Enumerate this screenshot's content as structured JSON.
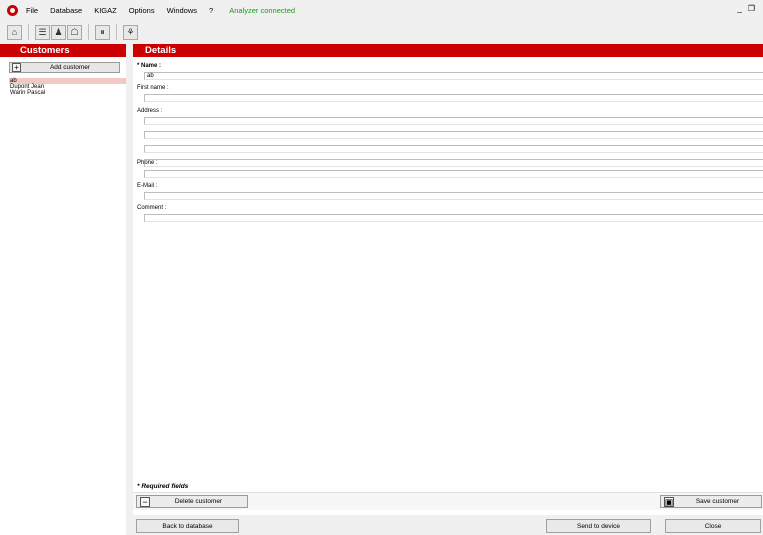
{
  "menubar": {
    "items": [
      "File",
      "Database",
      "KIGAZ",
      "Options",
      "Windows",
      "?"
    ],
    "status": "Analyzer connected",
    "minimize": "_",
    "restore": "❐"
  },
  "toolbar": {
    "icons": [
      "home-icon",
      "database-icon",
      "customer-icon",
      "site-icon",
      "analyzer-icon",
      "tools-icon"
    ],
    "glyphs": [
      "⌂",
      "☰",
      "♟",
      "☖",
      "⏸",
      "⚘"
    ]
  },
  "customers": {
    "header": "Customers",
    "add_button": "Add customer",
    "add_icon": "+",
    "list": [
      "ab",
      "Dupont Jean",
      "Warin Pascal"
    ],
    "selected_index": 0
  },
  "details": {
    "header": "Details",
    "name_label": "Name :",
    "name_value": "ab",
    "firstname_label": "First name :",
    "firstname_value": "",
    "address_label": "Address :",
    "address_lines": [
      "",
      "",
      "",
      ""
    ],
    "phone_label": "Phone :",
    "phone_value": "",
    "email_label": "E-Mail :",
    "email_value": "",
    "comment_label": "Comment :",
    "comment_value": "",
    "required_note": "Required fields",
    "required_marker": "*",
    "delete_button": "Delete customer",
    "delete_icon": "−",
    "save_button": "Save customer",
    "save_icon": "▣"
  },
  "footer": {
    "back_button": "Back to database",
    "send_button": "Send to device",
    "close_button": "Close"
  },
  "colors": {
    "header_red": "#cc0000",
    "selection": "#f2c9c2",
    "status_green": "#1a9a1a"
  }
}
